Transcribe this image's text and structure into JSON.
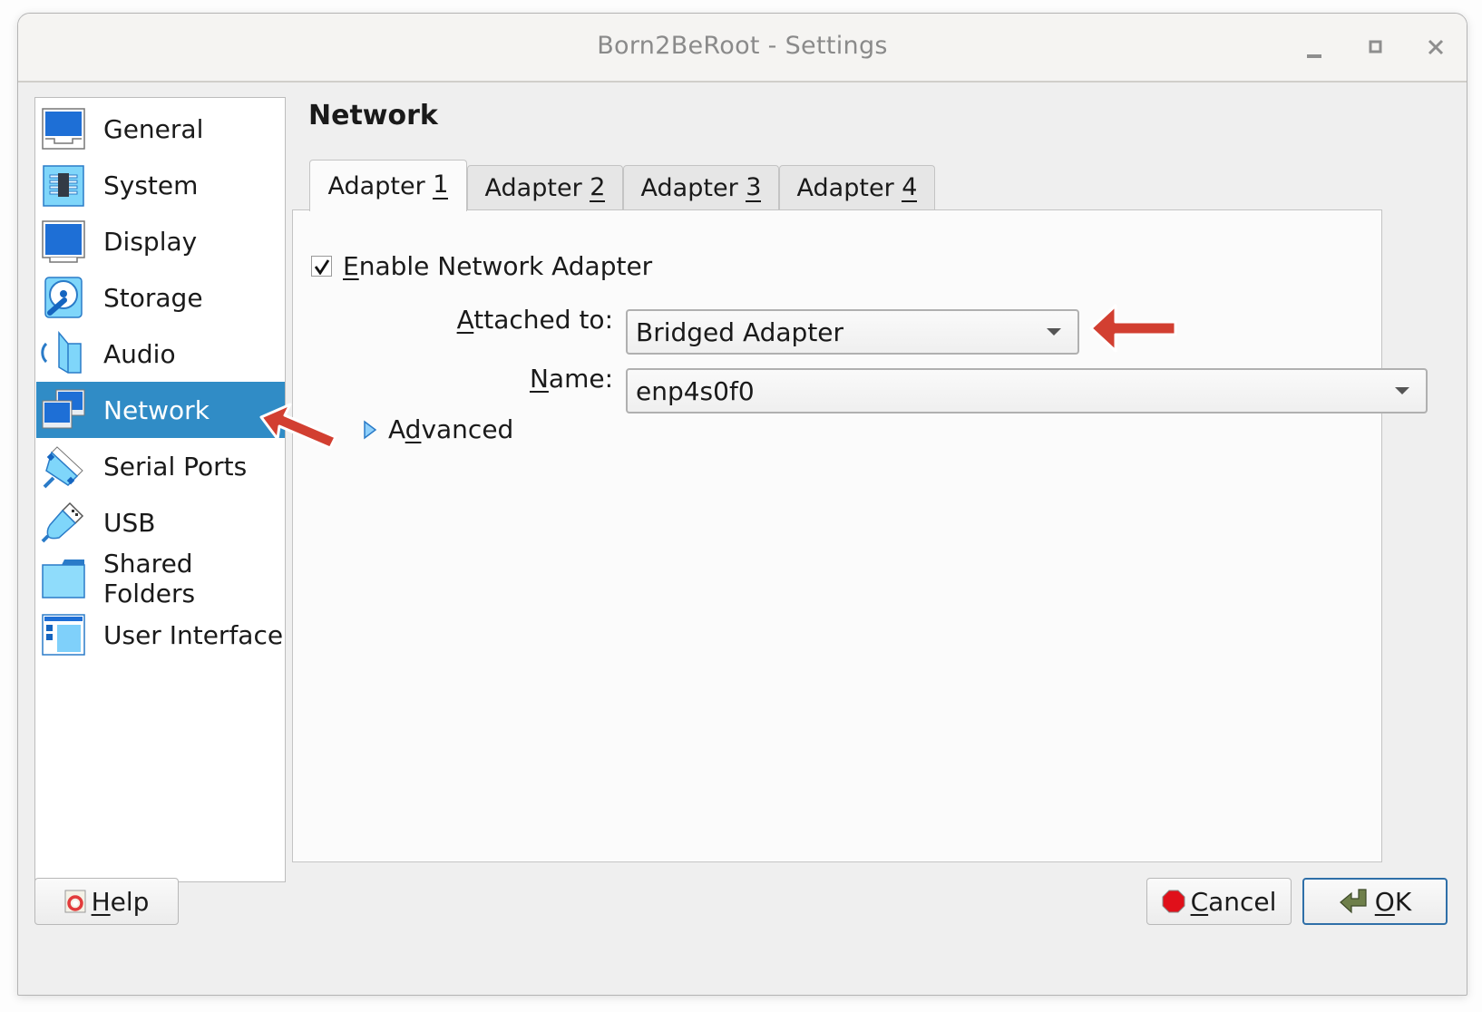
{
  "window": {
    "title": "Born2BeRoot - Settings",
    "controls": [
      "minimize",
      "maximize",
      "close"
    ]
  },
  "sidebar": {
    "selected": "Network",
    "items": [
      {
        "label": "General",
        "icon": "monitor-icon"
      },
      {
        "label": "System",
        "icon": "chip-icon"
      },
      {
        "label": "Display",
        "icon": "display-icon"
      },
      {
        "label": "Storage",
        "icon": "hard-disk-icon"
      },
      {
        "label": "Audio",
        "icon": "speaker-icon"
      },
      {
        "label": "Network",
        "icon": "network-icon"
      },
      {
        "label": "Serial Ports",
        "icon": "serial-port-icon"
      },
      {
        "label": "USB",
        "icon": "usb-icon"
      },
      {
        "label": "Shared Folders",
        "icon": "folder-icon"
      },
      {
        "label": "User Interface",
        "icon": "user-interface-icon"
      }
    ]
  },
  "main": {
    "title": "Network",
    "tabs": [
      {
        "prefix": "Adapter ",
        "mnemonic": "1",
        "active": true
      },
      {
        "prefix": "Adapter ",
        "mnemonic": "2",
        "active": false
      },
      {
        "prefix": "Adapter ",
        "mnemonic": "3",
        "active": false
      },
      {
        "prefix": "Adapter ",
        "mnemonic": "4",
        "active": false
      }
    ],
    "enable_adapter": {
      "mnemonic": "E",
      "rest": "nable Network Adapter",
      "checked": true
    },
    "attached_to": {
      "mnemonic": "A",
      "rest": "ttached to:",
      "value": "Bridged Adapter"
    },
    "name": {
      "mnemonic": "N",
      "rest": "ame:",
      "value": "enp4s0f0"
    },
    "advanced": {
      "pre": "A",
      "mnemonic": "d",
      "rest": "vanced",
      "expanded": false
    }
  },
  "buttons": {
    "help": {
      "mnemonic": "H",
      "rest": "elp"
    },
    "cancel": {
      "mnemonic": "C",
      "rest": "ancel"
    },
    "ok": {
      "mnemonic": "O",
      "rest": "K"
    }
  },
  "annotations": {
    "arrow_color": "#d23f31"
  },
  "colors": {
    "selection": "#308cc6",
    "icon_blue": "#1565c0"
  }
}
